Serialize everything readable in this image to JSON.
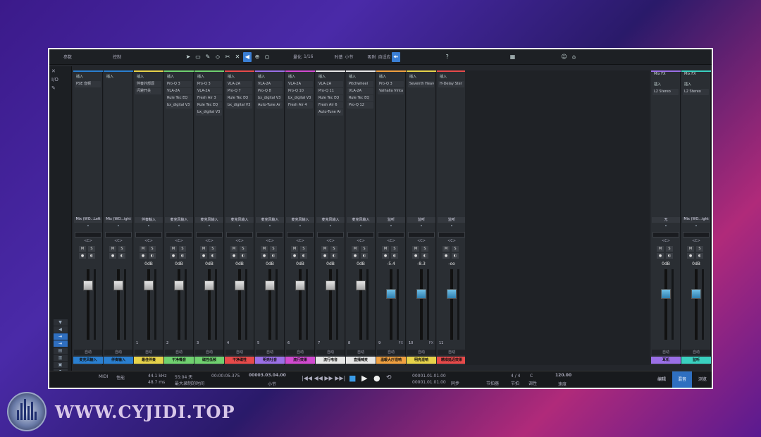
{
  "toolbar": {
    "param_label": "参数",
    "ctrl_label": "控制",
    "quant_label": "量化",
    "quant_val": "1/16",
    "timebase_label": "时基",
    "timebase_val": "小节",
    "snap_label": "吸附",
    "snap_val": "自适应",
    "help": "?"
  },
  "channels": [
    {
      "name": "Mix (WO...Left",
      "db": "",
      "label": "麦克风输入",
      "color": "#2a7fd0",
      "slots": [
        "插入",
        "PSE 音频"
      ],
      "extra": "0.0 dB"
    },
    {
      "name": "Mix (WO...ight",
      "db": "",
      "label": "伴奏输入",
      "color": "#2a7fd0",
      "slots": [
        "插入"
      ],
      "extra": "0.0 dB"
    },
    {
      "name": "伴奏輸入",
      "db": "0dB",
      "label": "最佳伴奏",
      "color": "#e6d24a",
      "slots": [
        "插入",
        "伴奏外部源",
        "闪避开关"
      ],
      "num": "1"
    },
    {
      "name": "麦克风输入",
      "db": "0dB",
      "label": "干净嗓音",
      "color": "#6fd06f",
      "slots": [
        "插入",
        "Pro-Q 3",
        "VLA-2A",
        "Rule Tec EQ",
        "bx_digital V3"
      ],
      "num": "2"
    },
    {
      "name": "麦克风输入",
      "db": "0dB",
      "label": "磁性低频",
      "color": "#6fd06f",
      "slots": [
        "插入",
        "Pro-Q 3",
        "VLA-2A",
        "Fresh Air 3",
        "Rule Tec EQ",
        "bx_digital V3"
      ],
      "num": "3"
    },
    {
      "name": "麦克风输入",
      "db": "0dB",
      "label": "干净磁性",
      "color": "#e64a4a",
      "slots": [
        "插入",
        "VLA-2A",
        "Pro-Q 7",
        "Rule Tec EQ",
        "bx_digital V3"
      ],
      "num": "4"
    },
    {
      "name": "麦克风输入",
      "db": "0dB",
      "label": "明亮吐音",
      "color": "#9a6fe6",
      "slots": [
        "插入",
        "VLA-2A",
        "Pro-Q 8",
        "bx_digital V3",
        "Auto-Tune Ar"
      ],
      "num": "5"
    },
    {
      "name": "麦克风输入",
      "db": "0dB",
      "label": "流行效果",
      "color": "#d04ad0",
      "slots": [
        "插入",
        "VLA-2A",
        "Pro-Q 10",
        "bx_digital V3",
        "Fresh Air 4"
      ],
      "num": "6"
    },
    {
      "name": "麦克风输入",
      "db": "0dB",
      "label": "流行电音",
      "color": "#e6e6e6",
      "slots": [
        "插入",
        "VLA-2A",
        "Pro-Q 11",
        "Rule Tec EQ",
        "Fresh Air 6",
        "Auto-Tune Ar"
      ],
      "num": "7"
    },
    {
      "name": "麦克风输入",
      "db": "0dB",
      "label": "直播喊麦",
      "color": "#e6e6e6",
      "slots": [
        "插入",
        "Pitchwheel",
        "VLA-2A",
        "Rule Tec EQ",
        "Pro-Q 12"
      ],
      "num": "8"
    },
    {
      "name": "监听",
      "db": "-5.4",
      "label": "温暖大厅混响",
      "color": "#f0a040",
      "slots": [
        "插入",
        "Pro-Q 3",
        "Valhalla Vinta"
      ],
      "num": "9",
      "fx": "FX"
    },
    {
      "name": "监听",
      "db": "-8.3",
      "label": "明亮混响",
      "color": "#e6d24a",
      "slots": [
        "插入",
        "Seventh Heav"
      ],
      "num": "10",
      "fx": "FX"
    },
    {
      "name": "监听",
      "db": "-oo",
      "label": "精准延迟效果",
      "color": "#e64a4a",
      "slots": [
        "插入",
        "H-Delay Ster"
      ],
      "num": "11"
    }
  ],
  "right_channels": [
    {
      "title": "Mix FX",
      "name": "无",
      "db": "0dB",
      "label": "耳机",
      "color": "#9a6fe6",
      "slots": [
        "插入",
        "L2 Stereo"
      ]
    },
    {
      "title": "Mix FX",
      "name": "Mix (WO...ight",
      "db": "0dB",
      "label": "监听",
      "color": "#3ad0c0",
      "slots": [
        "插入",
        "L2 Stereo"
      ]
    }
  ],
  "transport": {
    "sr": "44.1 kHz",
    "lat": "48.7 ms",
    "dur": "55:04 天",
    "dur_label": "最大录制的时间",
    "time": "00:00:05.375",
    "bars": "00003.03.04.00",
    "bars_label": "小节",
    "l_pos": "00001.01.01.00",
    "r_pos": "00001.01.01.00",
    "sig": "4 / 4",
    "tempo": "120.00",
    "tempo_label": "速度",
    "sync": "同步",
    "metro": "节拍器",
    "ts_label": "节拍",
    "key_label": "调性",
    "key_val": "C",
    "tab1": "编辑",
    "tab2": "混音",
    "tab3": "浏览"
  },
  "watermark": "WWW.CYJIDI.TOP"
}
